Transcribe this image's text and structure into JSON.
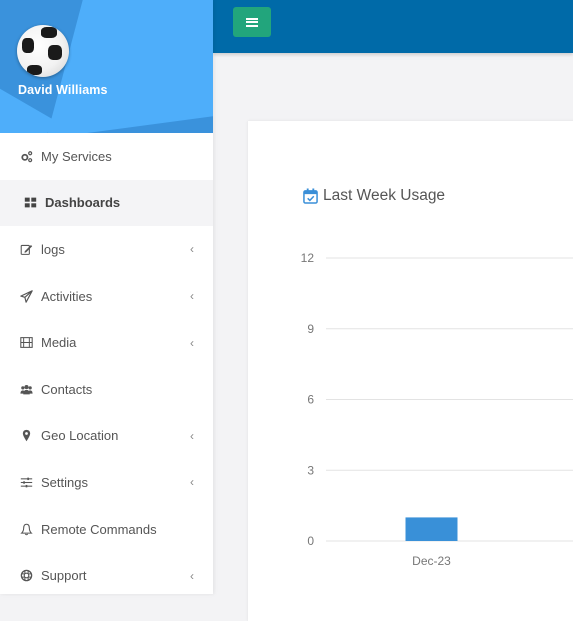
{
  "user": {
    "name": "David Williams",
    "avatar": "soccer-ball"
  },
  "topbar": {
    "menu_button_icon": "hamburger-icon"
  },
  "sidebar": {
    "items": [
      {
        "label": "My Services",
        "icon": "cogs-icon",
        "has_submenu": false,
        "active": false
      },
      {
        "label": "Dashboards",
        "icon": "th-large-icon",
        "has_submenu": false,
        "active": true
      },
      {
        "label": "logs",
        "icon": "edit-icon",
        "has_submenu": true,
        "active": false
      },
      {
        "label": "Activities",
        "icon": "paper-plane-icon",
        "has_submenu": true,
        "active": false
      },
      {
        "label": "Media",
        "icon": "film-icon",
        "has_submenu": true,
        "active": false
      },
      {
        "label": "Contacts",
        "icon": "users-icon",
        "has_submenu": false,
        "active": false
      },
      {
        "label": "Geo Location",
        "icon": "map-marker-icon",
        "has_submenu": true,
        "active": false
      },
      {
        "label": "Settings",
        "icon": "sliders-icon",
        "has_submenu": true,
        "active": false
      },
      {
        "label": "Remote Commands",
        "icon": "bell-icon",
        "has_submenu": false,
        "active": false
      },
      {
        "label": "Support",
        "icon": "life-ring-icon",
        "has_submenu": true,
        "active": false
      }
    ],
    "chevron": "‹"
  },
  "card": {
    "title": "Last Week Usage",
    "title_icon": "calendar-check-icon"
  },
  "colors": {
    "topbar": "#006aa8",
    "menu_button": "#22a57c",
    "profile_bg": "#3a92dc",
    "bar": "#3990d8",
    "title_icon": "#3a8fd8"
  },
  "chart_data": {
    "type": "bar",
    "title": "Last Week Usage",
    "categories": [
      "Dec-23"
    ],
    "values": [
      1
    ],
    "xlabel": "",
    "ylabel": "",
    "ylim": [
      0,
      12
    ],
    "yticks": [
      0,
      3,
      6,
      9,
      12
    ],
    "grid": true,
    "legend": "none"
  }
}
